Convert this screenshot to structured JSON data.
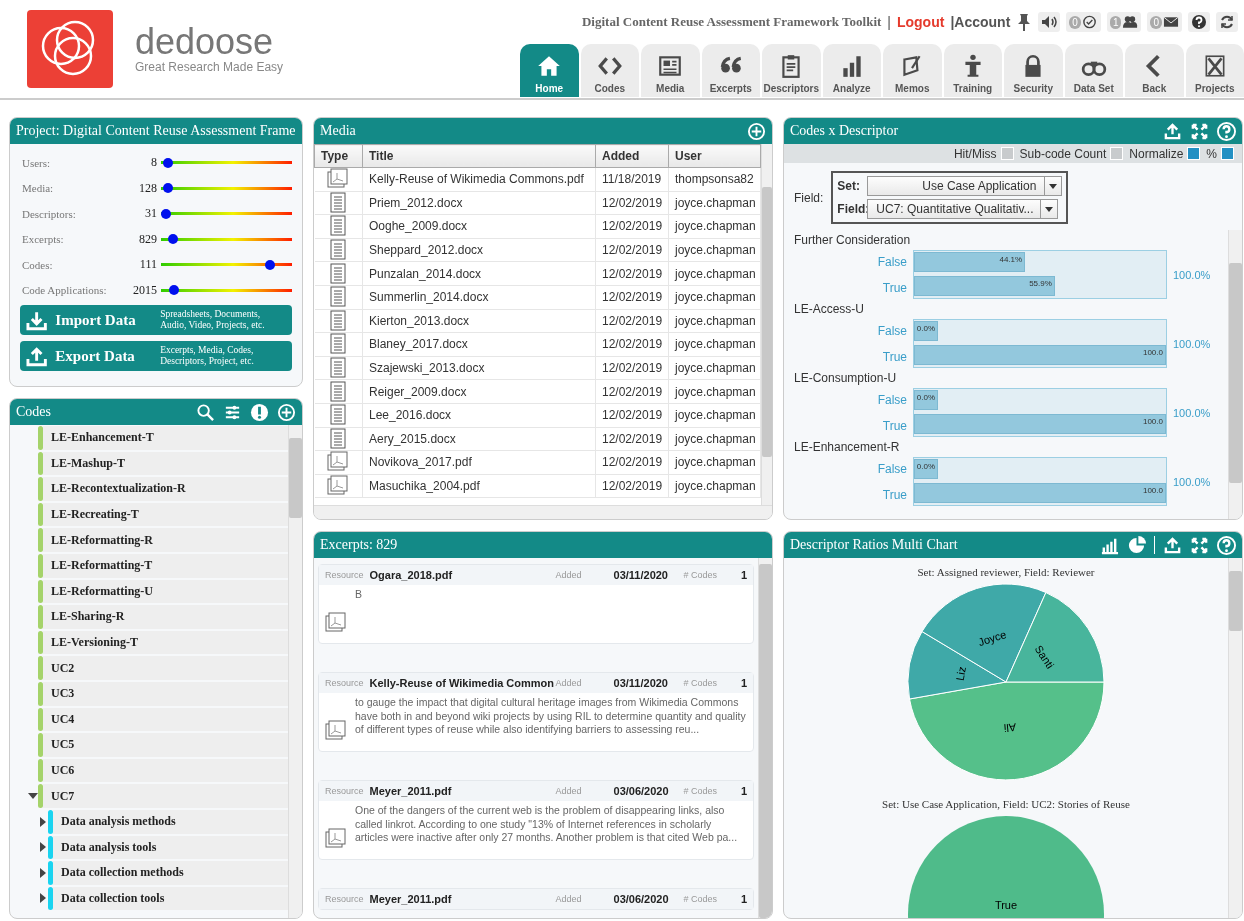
{
  "app": {
    "logo_name": "dedoose",
    "tagline": "Great Research Made Easy"
  },
  "top_bar": {
    "project_title": "Digital Content Reuse Assessment Framework Toolkit",
    "separator": "|",
    "logout": "Logout",
    "account": "|Account",
    "badges": [
      {
        "kind": "tasks",
        "count": "0"
      },
      {
        "kind": "people",
        "count": "1"
      },
      {
        "kind": "mail",
        "count": "0"
      }
    ]
  },
  "nav_tabs": [
    {
      "label": "Home",
      "selected": true
    },
    {
      "label": "Codes",
      "selected": false
    },
    {
      "label": "Media",
      "selected": false
    },
    {
      "label": "Excerpts",
      "selected": false
    },
    {
      "label": "Descriptors",
      "selected": false
    },
    {
      "label": "Analyze",
      "selected": false
    },
    {
      "label": "Memos",
      "selected": false
    },
    {
      "label": "Training",
      "selected": false
    },
    {
      "label": "Security",
      "selected": false
    },
    {
      "label": "Data Set",
      "selected": false
    },
    {
      "label": "Back",
      "selected": false
    },
    {
      "label": "Projects",
      "selected": false
    }
  ],
  "project_panel": {
    "title": "Project: Digital Content Reuse Assessment Frame",
    "stats": [
      {
        "label": "Users:",
        "value": "8",
        "level": 0.02
      },
      {
        "label": "Media:",
        "value": "128",
        "level": 0.02
      },
      {
        "label": "Descriptors:",
        "value": "31",
        "level": 0.0
      },
      {
        "label": "Excerpts:",
        "value": "829",
        "level": 0.06
      },
      {
        "label": "Codes:",
        "value": "111",
        "level": 0.86
      },
      {
        "label": "Code Applications:",
        "value": "2015",
        "level": 0.07
      }
    ],
    "actions": [
      {
        "kind": "import",
        "label": "Import Data",
        "hint": "Spreadsheets, Documents, Audio, Video, Projects, etc."
      },
      {
        "kind": "export",
        "label": "Export Data",
        "hint": "Excerpts, Media, Codes, Descriptors, Project, etc."
      }
    ]
  },
  "codes_panel": {
    "title": "Codes",
    "codes": [
      {
        "name": "LE-Enhancement-T",
        "color": "#a5d36a"
      },
      {
        "name": "LE-Mashup-T",
        "color": "#a5d36a"
      },
      {
        "name": "LE-Recontextualization-R",
        "color": "#a5d36a"
      },
      {
        "name": "LE-Recreating-T",
        "color": "#a5d36a"
      },
      {
        "name": "LE-Reformatting-R",
        "color": "#a5d36a"
      },
      {
        "name": "LE-Reformatting-T",
        "color": "#a5d36a"
      },
      {
        "name": "LE-Reformatting-U",
        "color": "#a5d36a"
      },
      {
        "name": "LE-Sharing-R",
        "color": "#a5d36a"
      },
      {
        "name": "LE-Versioning-T",
        "color": "#a5d36a"
      },
      {
        "name": "UC2",
        "color": "#a5d36a"
      },
      {
        "name": "UC3",
        "color": "#a5d36a"
      },
      {
        "name": "UC4",
        "color": "#a5d36a"
      },
      {
        "name": "UC5",
        "color": "#a5d36a"
      },
      {
        "name": "UC6",
        "color": "#a5d36a"
      },
      {
        "name": "UC7",
        "color": "#a5d36a",
        "expanded": true,
        "children": [
          {
            "name": "Data analysis methods",
            "color": "#1ad4f0",
            "expanded": false
          },
          {
            "name": "Data analysis tools",
            "color": "#1ad4f0",
            "expanded": false
          },
          {
            "name": "Data collection methods",
            "color": "#1ad4f0",
            "expanded": false
          },
          {
            "name": "Data collection tools",
            "color": "#1ad4f0",
            "expanded": false
          }
        ]
      }
    ]
  },
  "media_panel": {
    "title": "Media",
    "columns": [
      "Type",
      "Title",
      "Added",
      "User"
    ],
    "rows": [
      {
        "kind": "pdf",
        "title": "Kelly-Reuse of Wikimedia Commons.pdf",
        "added": "11/18/2019",
        "user": "thompsonsa82"
      },
      {
        "kind": "doc",
        "title": "Priem_2012.docx",
        "added": "12/02/2019",
        "user": "joyce.chapman"
      },
      {
        "kind": "doc",
        "title": "Ooghe_2009.docx",
        "added": "12/02/2019",
        "user": "joyce.chapman"
      },
      {
        "kind": "doc",
        "title": "Sheppard_2012.docx",
        "added": "12/02/2019",
        "user": "joyce.chapman"
      },
      {
        "kind": "doc",
        "title": "Punzalan_2014.docx",
        "added": "12/02/2019",
        "user": "joyce.chapman"
      },
      {
        "kind": "doc",
        "title": "Summerlin_2014.docx",
        "added": "12/02/2019",
        "user": "joyce.chapman"
      },
      {
        "kind": "doc",
        "title": "Kierton_2013.docx",
        "added": "12/02/2019",
        "user": "joyce.chapman"
      },
      {
        "kind": "doc",
        "title": "Blaney_2017.docx",
        "added": "12/02/2019",
        "user": "joyce.chapman"
      },
      {
        "kind": "doc",
        "title": "Szajewski_2013.docx",
        "added": "12/02/2019",
        "user": "joyce.chapman"
      },
      {
        "kind": "doc",
        "title": "Reiger_2009.docx",
        "added": "12/02/2019",
        "user": "joyce.chapman"
      },
      {
        "kind": "doc",
        "title": "Lee_2016.docx",
        "added": "12/02/2019",
        "user": "joyce.chapman"
      },
      {
        "kind": "doc",
        "title": "Aery_2015.docx",
        "added": "12/02/2019",
        "user": "joyce.chapman"
      },
      {
        "kind": "pdf",
        "title": "Novikova_2017.pdf",
        "added": "12/02/2019",
        "user": "joyce.chapman"
      },
      {
        "kind": "pdf",
        "title": "Masuchika_2004.pdf",
        "added": "12/02/2019",
        "user": "joyce.chapman"
      }
    ]
  },
  "excerpts_panel": {
    "title": "Excerpts: 829",
    "excerpts": [
      {
        "resource_label": "Resource",
        "resource": "Ogara_2018.pdf",
        "added_label": "Added",
        "added": "03/11/2020",
        "codes_label": "# Codes",
        "codes": "1",
        "text": "B"
      },
      {
        "resource_label": "Resource",
        "resource": "Kelly-Reuse of Wikimedia Common",
        "added_label": "Added",
        "added": "03/11/2020",
        "codes_label": "# Codes",
        "codes": "1",
        "text": "to gauge the impact that digital cultural heritage images from Wikimedia Commons have both in and beyond wiki projects by using RIL to determine quantity and quality of different types of reuse while also identifying barriers to assessing reu..."
      },
      {
        "resource_label": "Resource",
        "resource": "Meyer_2011.pdf",
        "added_label": "Added",
        "added": "03/06/2020",
        "codes_label": "# Codes",
        "codes": "1",
        "text": "One of the dangers of the current web is the problem of disappearing links, also called linkrot. According to one study \"13% of Internet references in scholarly articles were inactive after only 27 months. Another problem is that cited Web pa..."
      },
      {
        "resource_label": "Resource",
        "resource": "Meyer_2011.pdf",
        "added_label": "Added",
        "added": "03/06/2020",
        "codes_label": "# Codes",
        "codes": "1"
      }
    ]
  },
  "codes_descriptor_panel": {
    "title": "Codes x Descriptor",
    "options": [
      {
        "label": "Hit/Miss",
        "checked": false
      },
      {
        "label": "Sub-code Count",
        "checked": false
      },
      {
        "label": "Normalize",
        "checked": true
      },
      {
        "label": "%",
        "checked": true
      }
    ],
    "field_label": "Field:",
    "set_label": "Set:",
    "set_value": "Use Case Application",
    "field_select_label": "Field:",
    "field_value": "UC7: Quantitative Qualitativ...",
    "groups": [
      {
        "name": "Further Consideration",
        "total": "100.0%",
        "bars": [
          {
            "label": "False",
            "level": 0.441,
            "value": "44.1%"
          },
          {
            "label": "True",
            "level": 0.559,
            "value": "55.9%"
          }
        ]
      },
      {
        "name": "LE-Access-U",
        "total": "100.0%",
        "bars": [
          {
            "label": "False",
            "level": 0,
            "value": "0.0%"
          },
          {
            "label": "True",
            "level": 1,
            "value": "100.0"
          }
        ]
      },
      {
        "name": "LE-Consumption-U",
        "total": "100.0%",
        "bars": [
          {
            "label": "False",
            "level": 0,
            "value": "0.0%"
          },
          {
            "label": "True",
            "level": 1,
            "value": "100.0"
          }
        ]
      },
      {
        "name": "LE-Enhancement-R",
        "total": "100.0%",
        "bars": [
          {
            "label": "False",
            "level": 0,
            "value": "0.0%"
          },
          {
            "label": "True",
            "level": 1,
            "value": "100.0"
          }
        ]
      }
    ]
  },
  "ratios_panel": {
    "title": "Descriptor Ratios Multi Chart",
    "charts": [
      {
        "title": "Set: Assigned reviewer, Field: Reviewer",
        "slices": [
          {
            "label": "Ali"
          },
          {
            "label": "Liz"
          },
          {
            "label": "Joyce"
          },
          {
            "label": "Santi"
          }
        ]
      },
      {
        "title": "Set: Use Case Application, Field: UC2: Stories of Reuse",
        "slices": [
          {
            "label": "True"
          }
        ]
      }
    ]
  }
}
